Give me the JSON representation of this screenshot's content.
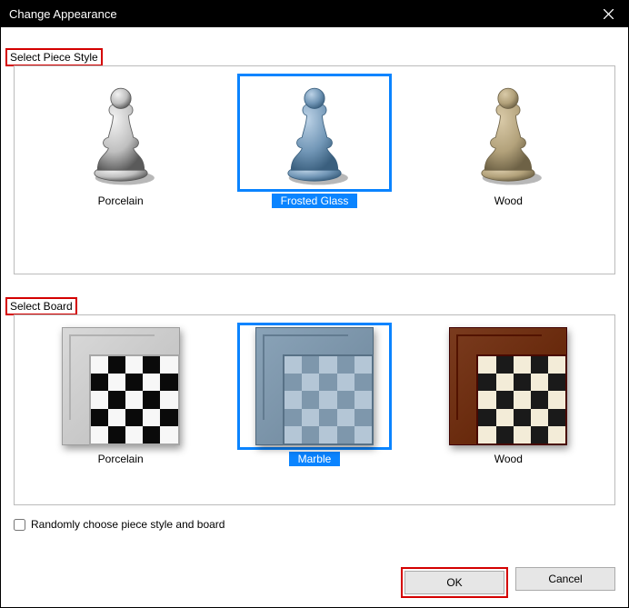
{
  "window": {
    "title": "Change Appearance"
  },
  "sections": {
    "piece_label": "Select Piece Style",
    "board_label": "Select Board"
  },
  "piece_options": [
    {
      "label": "Porcelain",
      "selected": false
    },
    {
      "label": "Frosted Glass",
      "selected": true
    },
    {
      "label": "Wood",
      "selected": false
    }
  ],
  "board_options": [
    {
      "label": "Porcelain",
      "selected": false
    },
    {
      "label": "Marble",
      "selected": true
    },
    {
      "label": "Wood",
      "selected": false
    }
  ],
  "checkbox": {
    "label": "Randomly choose piece style and board",
    "checked": false
  },
  "buttons": {
    "ok": "OK",
    "cancel": "Cancel"
  },
  "colors": {
    "piece": {
      "porcelain": {
        "light": "#f2f2f2",
        "mid": "#bfbfbf",
        "dark": "#5a5a5a"
      },
      "frosted_glass": {
        "light": "#bcd2e6",
        "mid": "#7196b6",
        "dark": "#3a5f7e"
      },
      "wood": {
        "light": "#d9caa8",
        "mid": "#b2a17a",
        "dark": "#6e6246"
      }
    },
    "board": {
      "porcelain": {
        "frame": "#d9d9d9",
        "light": "#f7f7f7",
        "dark": "#0a0a0a"
      },
      "marble": {
        "frame": "#8aa3b8",
        "light": "#b4c6d6",
        "dark": "#7e97ac"
      },
      "wood": {
        "frame": "#7a3b1e",
        "light": "#f3ecd8",
        "dark": "#1a1a1a"
      }
    }
  }
}
